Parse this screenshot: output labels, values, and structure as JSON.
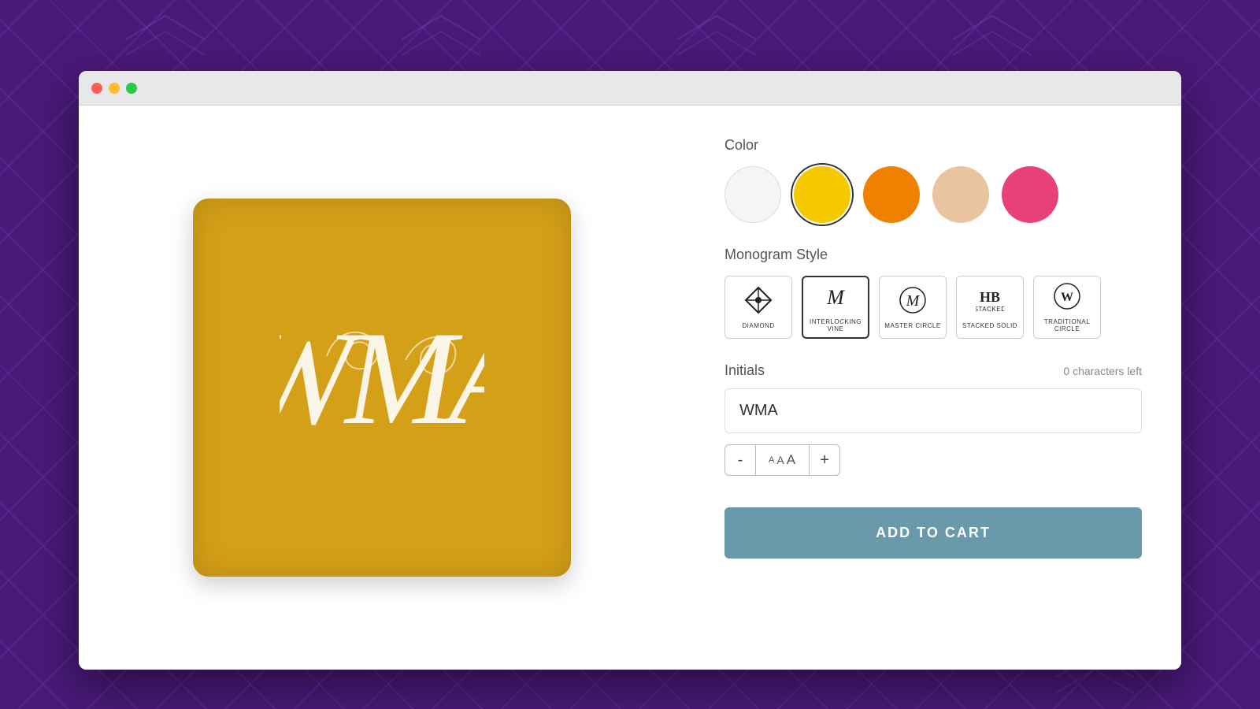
{
  "background": {
    "color": "#4a1a7a"
  },
  "browser": {
    "traffic_lights": {
      "close": "close-light",
      "minimize": "minimize-light",
      "maximize": "maximize-light"
    }
  },
  "product": {
    "pillow_color": "#d4a017",
    "monogram_text": "WMA"
  },
  "color_section": {
    "label": "Color",
    "swatches": [
      {
        "id": "white",
        "color": "#f5f5f5",
        "selected": false
      },
      {
        "id": "yellow",
        "color": "#f5c800",
        "selected": true
      },
      {
        "id": "orange",
        "color": "#f08000",
        "selected": false
      },
      {
        "id": "peach",
        "color": "#e8c4a0",
        "selected": false
      },
      {
        "id": "pink",
        "color": "#e8407a",
        "selected": false
      }
    ]
  },
  "monogram_section": {
    "label": "Monogram Style",
    "styles": [
      {
        "id": "diamond",
        "name": "Diamond",
        "icon": "◈"
      },
      {
        "id": "interlocking-vine",
        "name": "Interlocking Vine",
        "icon": "𝔐",
        "selected": true
      },
      {
        "id": "master-circle",
        "name": "Master Circle",
        "icon": "𝔓"
      },
      {
        "id": "stacked-solid",
        "name": "Stacked Solid",
        "icon": "𝔅"
      },
      {
        "id": "traditional-circle",
        "name": "Traditional Circle",
        "icon": "𝔚"
      }
    ]
  },
  "initials_section": {
    "label": "Initials",
    "chars_left_label": "0 characters left",
    "value": "WMA",
    "placeholder": ""
  },
  "size_controls": {
    "minus_label": "-",
    "size_label": "AAA",
    "plus_label": "+"
  },
  "add_to_cart": {
    "label": "ADD TO CART"
  }
}
